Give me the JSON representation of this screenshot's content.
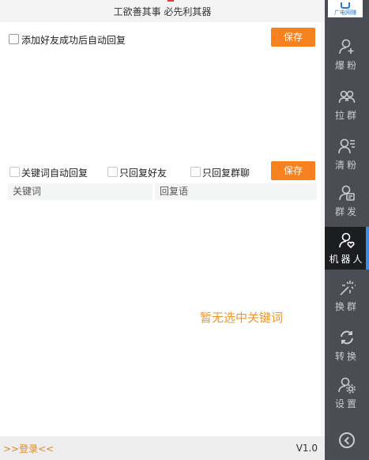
{
  "header": {
    "motto": "工欲善其事  必先利其器"
  },
  "friend_section": {
    "auto_reply_label": "添加好友成功后自动回复",
    "save_label": "保存"
  },
  "keyword_section": {
    "keyword_auto_reply_label": "关键词自动回复",
    "friends_only_label": "只回复好友",
    "groups_only_label": "只回复群聊",
    "save_label": "保存",
    "columns": [
      "关键词",
      "回复语"
    ],
    "empty_text": "暂无选中关键词"
  },
  "footer": {
    "login_label": ">>登录<<",
    "version": "V1.0"
  },
  "sidebar": {
    "logo_text": "广电网赚",
    "items": [
      {
        "label": "爆粉",
        "icon": "user-plus-icon"
      },
      {
        "label": "拉群",
        "icon": "group-icon"
      },
      {
        "label": "清粉",
        "icon": "user-list-icon"
      },
      {
        "label": "群发",
        "icon": "user-message-icon"
      },
      {
        "label": "机器人",
        "icon": "robot-user-icon",
        "active": true
      },
      {
        "label": "换群",
        "icon": "magic-wand-icon"
      },
      {
        "label": "转换",
        "icon": "refresh-icon"
      },
      {
        "label": "设置",
        "icon": "user-settings-icon"
      }
    ],
    "back_icon": "chevron-left-circle-icon"
  },
  "colors": {
    "accent": "#f5821f",
    "sidebar_bg": "#4a4e54",
    "active_bg": "#1c1d20",
    "active_marker": "#3a8ee6"
  }
}
